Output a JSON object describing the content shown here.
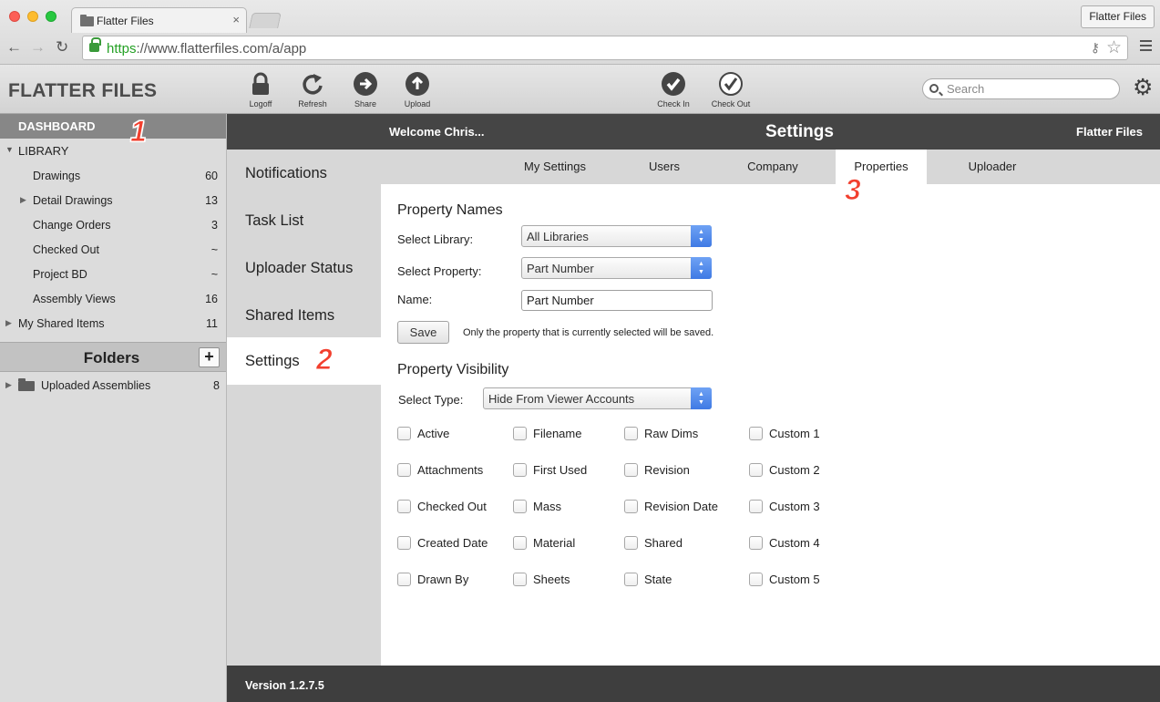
{
  "browser": {
    "tab_title": "Flatter Files",
    "tab_close": "×",
    "profile_button": "Flatter Files",
    "url_scheme": "https",
    "url_rest": "://www.flatterfiles.com/a/app",
    "back_glyph": "←",
    "forward_glyph": "→",
    "reload_glyph": "↻",
    "star_glyph": "☆",
    "key_glyph": "⚷"
  },
  "toolbar": {
    "logo": "FLATTER FILES",
    "tools": [
      {
        "label": "Logoff",
        "icon": "lock-icon"
      },
      {
        "label": "Refresh",
        "icon": "refresh-icon"
      },
      {
        "label": "Share",
        "icon": "share-icon"
      },
      {
        "label": "Upload",
        "icon": "upload-icon"
      },
      {
        "label": "Check In",
        "icon": "check-in-icon"
      },
      {
        "label": "Check Out",
        "icon": "check-out-icon"
      }
    ],
    "search_placeholder": "Search",
    "settings_icon": "gear-icon"
  },
  "sidebar": {
    "dashboard": "DASHBOARD",
    "library_label": "LIBRARY",
    "library_items": [
      {
        "label": "Drawings",
        "count": "60"
      },
      {
        "label": "Detail Drawings",
        "count": "13"
      },
      {
        "label": "Change Orders",
        "count": "3"
      },
      {
        "label": "Checked Out",
        "count": "~"
      },
      {
        "label": "Project BD",
        "count": "~"
      },
      {
        "label": "Assembly Views",
        "count": "16"
      }
    ],
    "shared_items": {
      "label": "My Shared Items",
      "count": "11"
    },
    "folders_title": "Folders",
    "add_folder": "+",
    "folders": [
      {
        "label": "Uploaded Assemblies",
        "count": "8"
      }
    ]
  },
  "header": {
    "welcome": "Welcome Chris...",
    "title": "Settings",
    "brand": "Flatter Files"
  },
  "settings_nav": [
    {
      "label": "Notifications"
    },
    {
      "label": "Task List"
    },
    {
      "label": "Uploader Status"
    },
    {
      "label": "Shared Items"
    },
    {
      "label": "Settings",
      "active": true
    }
  ],
  "subtabs": [
    {
      "label": "My Settings"
    },
    {
      "label": "Users"
    },
    {
      "label": "Company"
    },
    {
      "label": "Properties",
      "active": true
    },
    {
      "label": "Uploader"
    }
  ],
  "property_names": {
    "title": "Property Names",
    "library_label": "Select Library:",
    "library_value": "All Libraries",
    "property_label": "Select Property:",
    "property_value": "Part Number",
    "name_label": "Name:",
    "name_value": "Part Number",
    "save_label": "Save",
    "note": "Only the property that is currently selected will be saved."
  },
  "property_visibility": {
    "title": "Property Visibility",
    "type_label": "Select Type:",
    "type_value": "Hide From Viewer Accounts",
    "columns": [
      [
        "Active",
        "Attachments",
        "Checked Out",
        "Created Date",
        "Drawn By"
      ],
      [
        "Filename",
        "First Used",
        "Mass",
        "Material",
        "Sheets"
      ],
      [
        "Raw Dims",
        "Revision",
        "Revision Date",
        "Shared",
        "State"
      ],
      [
        "Custom 1",
        "Custom 2",
        "Custom 3",
        "Custom 4",
        "Custom 5"
      ]
    ]
  },
  "footer": {
    "version": "Version 1.2.7.5"
  },
  "annotations": [
    "1",
    "2",
    "3"
  ]
}
